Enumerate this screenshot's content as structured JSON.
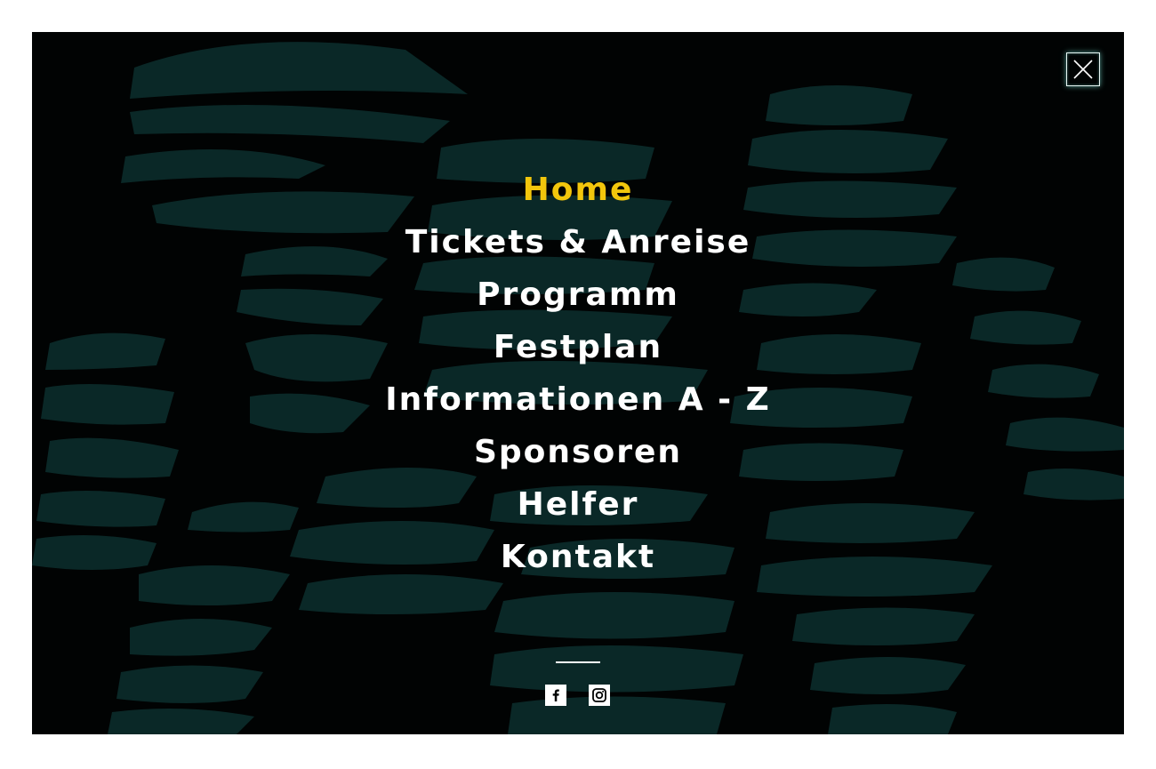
{
  "nav": {
    "items": [
      {
        "label": "Home",
        "active": true
      },
      {
        "label": "Tickets & Anreise",
        "active": false
      },
      {
        "label": "Programm",
        "active": false
      },
      {
        "label": "Festplan",
        "active": false
      },
      {
        "label": "Informationen A - Z",
        "active": false
      },
      {
        "label": "Sponsoren",
        "active": false
      },
      {
        "label": "Helfer",
        "active": false
      },
      {
        "label": "Kontakt",
        "active": false
      }
    ]
  },
  "social": {
    "icons": [
      "facebook-icon",
      "instagram-icon"
    ]
  },
  "close": {
    "icon": "close-icon"
  },
  "colors": {
    "background": "#010303",
    "accent": "#f2c60c",
    "nav_text": "#ffffff",
    "art": "#0a2827",
    "close_glow": "#6ec8be"
  }
}
